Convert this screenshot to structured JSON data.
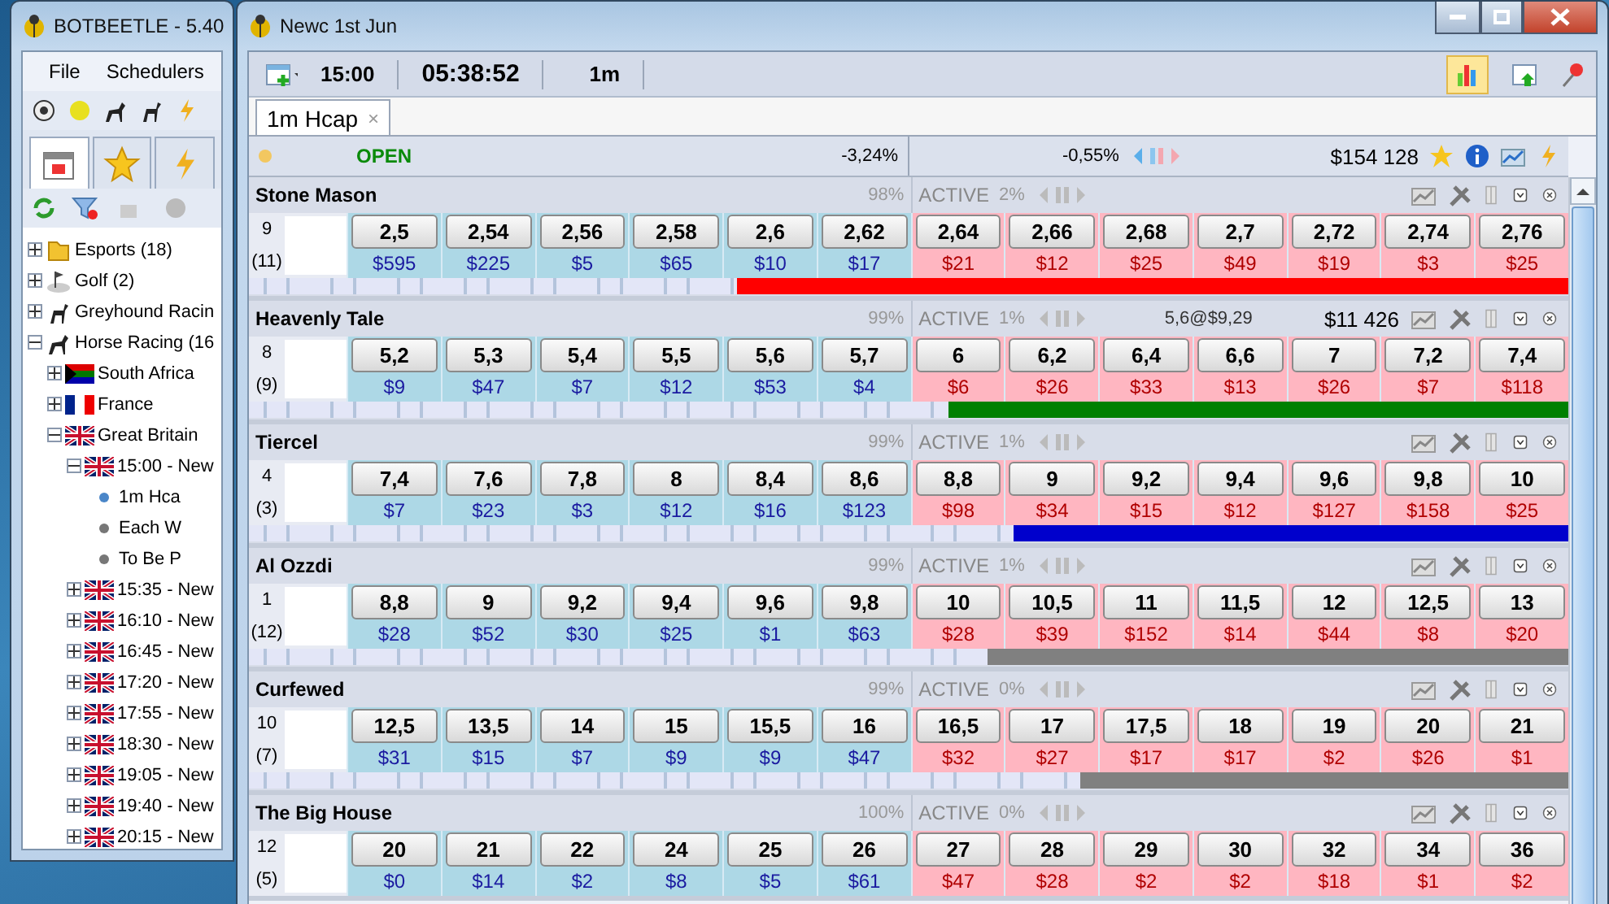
{
  "launcher": {
    "title": "BOTBEETLE - 5.40",
    "menu": [
      "File",
      "Schedulers"
    ],
    "tree": [
      {
        "label": "Esports (18)",
        "kind": "folder",
        "expanded": false
      },
      {
        "label": "Golf (2)",
        "kind": "golf",
        "expanded": false
      },
      {
        "label": "Greyhound Racin",
        "kind": "dog",
        "expanded": false
      },
      {
        "label": "Horse Racing (16",
        "kind": "horse",
        "expanded": true,
        "children": [
          {
            "label": "South Africa",
            "kind": "flag_za",
            "expanded": false
          },
          {
            "label": "France",
            "kind": "flag_fr",
            "expanded": false
          },
          {
            "label": "Great Britain",
            "kind": "flag_gb",
            "expanded": true,
            "children": [
              {
                "label": "15:00 - New",
                "kind": "flag_gb",
                "expanded": true,
                "children": [
                  {
                    "label": "1m Hca",
                    "kind": "market",
                    "selected": true
                  },
                  {
                    "label": "Each W",
                    "kind": "market",
                    "selected": false
                  },
                  {
                    "label": "To Be P",
                    "kind": "market",
                    "selected": false
                  }
                ]
              },
              {
                "label": "15:35 - New",
                "kind": "flag_gb",
                "expanded": false
              },
              {
                "label": "16:10 - New",
                "kind": "flag_gb",
                "expanded": false
              },
              {
                "label": "16:45 - New",
                "kind": "flag_gb",
                "expanded": false
              },
              {
                "label": "17:20 - New",
                "kind": "flag_gb",
                "expanded": false
              },
              {
                "label": "17:55 - New",
                "kind": "flag_gb",
                "expanded": false
              },
              {
                "label": "18:30 - New",
                "kind": "flag_gb",
                "expanded": false
              },
              {
                "label": "19:05 - New",
                "kind": "flag_gb",
                "expanded": false
              },
              {
                "label": "19:40 - New",
                "kind": "flag_gb",
                "expanded": false
              },
              {
                "label": "20:15 - New",
                "kind": "flag_gb",
                "expanded": false
              }
            ]
          }
        ]
      }
    ]
  },
  "market_window": {
    "title": "Newc 1st Jun",
    "start_time": "15:00",
    "countdown": "05:38:52",
    "distance": "1m",
    "chart_button": {
      "pressed": true
    },
    "tabs": [
      {
        "label": "1m Hcap",
        "selected": true,
        "close": "×"
      }
    ],
    "status": {
      "state": "OPEN",
      "back_book": "-3,24%",
      "lay_book": "-0,55%",
      "matched": "$154 128"
    },
    "runners": [
      {
        "name": "Stone Mason",
        "number": "9",
        "draw": "(11)",
        "back_pct": "98%",
        "status": "ACTIVE",
        "lay_pct": "2%",
        "back": [
          [
            "2,5",
            "$595"
          ],
          [
            "2,54",
            "$225"
          ],
          [
            "2,56",
            "$5"
          ],
          [
            "2,58",
            "$65"
          ],
          [
            "2,6",
            "$10"
          ],
          [
            "2,62",
            "$17"
          ]
        ],
        "lay": [
          [
            "2,64",
            "$21"
          ],
          [
            "2,66",
            "$12"
          ],
          [
            "2,68",
            "$25"
          ],
          [
            "2,7",
            "$49"
          ],
          [
            "2,72",
            "$19"
          ],
          [
            "2,74",
            "$3"
          ],
          [
            "2,76",
            "$25"
          ]
        ],
        "bar": {
          "color": "#ff0000",
          "level": 0.63
        }
      },
      {
        "name": "Heavenly Tale",
        "number": "8",
        "draw": "(9)",
        "back_pct": "99%",
        "status": "ACTIVE",
        "lay_pct": "1%",
        "position": "5,6@$9,29",
        "profit": "$11 426",
        "back": [
          [
            "5,2",
            "$9"
          ],
          [
            "5,3",
            "$47"
          ],
          [
            "5,4",
            "$7"
          ],
          [
            "5,5",
            "$12"
          ],
          [
            "5,6",
            "$53"
          ],
          [
            "5,7",
            "$4"
          ]
        ],
        "lay": [
          [
            "6",
            "$6"
          ],
          [
            "6,2",
            "$26"
          ],
          [
            "6,4",
            "$33"
          ],
          [
            "6,6",
            "$13"
          ],
          [
            "7",
            "$26"
          ],
          [
            "7,2",
            "$7"
          ],
          [
            "7,4",
            "$118"
          ]
        ],
        "bar": {
          "color": "#008000",
          "level": 0.47
        }
      },
      {
        "name": "Tiercel",
        "number": "4",
        "draw": "(3)",
        "back_pct": "99%",
        "status": "ACTIVE",
        "lay_pct": "1%",
        "back": [
          [
            "7,4",
            "$7"
          ],
          [
            "7,6",
            "$23"
          ],
          [
            "7,8",
            "$3"
          ],
          [
            "8",
            "$12"
          ],
          [
            "8,4",
            "$16"
          ],
          [
            "8,6",
            "$123"
          ]
        ],
        "lay": [
          [
            "8,8",
            "$98"
          ],
          [
            "9",
            "$34"
          ],
          [
            "9,2",
            "$15"
          ],
          [
            "9,4",
            "$12"
          ],
          [
            "9,6",
            "$127"
          ],
          [
            "9,8",
            "$158"
          ],
          [
            "10",
            "$25"
          ]
        ],
        "bar": {
          "color": "#0000cc",
          "level": 0.42
        }
      },
      {
        "name": "Al Ozzdi",
        "number": "1",
        "draw": "(12)",
        "back_pct": "99%",
        "status": "ACTIVE",
        "lay_pct": "1%",
        "back": [
          [
            "8,8",
            "$28"
          ],
          [
            "9",
            "$52"
          ],
          [
            "9,2",
            "$30"
          ],
          [
            "9,4",
            "$25"
          ],
          [
            "9,6",
            "$1"
          ],
          [
            "9,8",
            "$63"
          ]
        ],
        "lay": [
          [
            "10",
            "$28"
          ],
          [
            "10,5",
            "$39"
          ],
          [
            "11",
            "$152"
          ],
          [
            "11,5",
            "$14"
          ],
          [
            "12",
            "$44"
          ],
          [
            "12,5",
            "$8"
          ],
          [
            "13",
            "$20"
          ]
        ],
        "bar": {
          "color": "#808080",
          "level": 0.44
        }
      },
      {
        "name": "Curfewed",
        "number": "10",
        "draw": "(7)",
        "back_pct": "99%",
        "status": "ACTIVE",
        "lay_pct": "0%",
        "back": [
          [
            "12,5",
            "$31"
          ],
          [
            "13,5",
            "$15"
          ],
          [
            "14",
            "$7"
          ],
          [
            "15",
            "$9"
          ],
          [
            "15,5",
            "$9"
          ],
          [
            "16",
            "$47"
          ]
        ],
        "lay": [
          [
            "16,5",
            "$32"
          ],
          [
            "17",
            "$27"
          ],
          [
            "17,5",
            "$17"
          ],
          [
            "18",
            "$17"
          ],
          [
            "19",
            "$2"
          ],
          [
            "20",
            "$26"
          ],
          [
            "21",
            "$1"
          ]
        ],
        "bar": {
          "color": "#808080",
          "level": 0.37
        }
      },
      {
        "name": "The Big House",
        "number": "12",
        "draw": "(5)",
        "back_pct": "100%",
        "status": "ACTIVE",
        "lay_pct": "0%",
        "back": [
          [
            "20",
            "$0"
          ],
          [
            "21",
            "$14"
          ],
          [
            "22",
            "$2"
          ],
          [
            "24",
            "$8"
          ],
          [
            "25",
            "$5"
          ],
          [
            "26",
            "$61"
          ]
        ],
        "lay": [
          [
            "27",
            "$47"
          ],
          [
            "28",
            "$28"
          ],
          [
            "29",
            "$2"
          ],
          [
            "30",
            "$2"
          ],
          [
            "32",
            "$18"
          ],
          [
            "34",
            "$1"
          ],
          [
            "36",
            "$2"
          ]
        ]
      }
    ]
  }
}
